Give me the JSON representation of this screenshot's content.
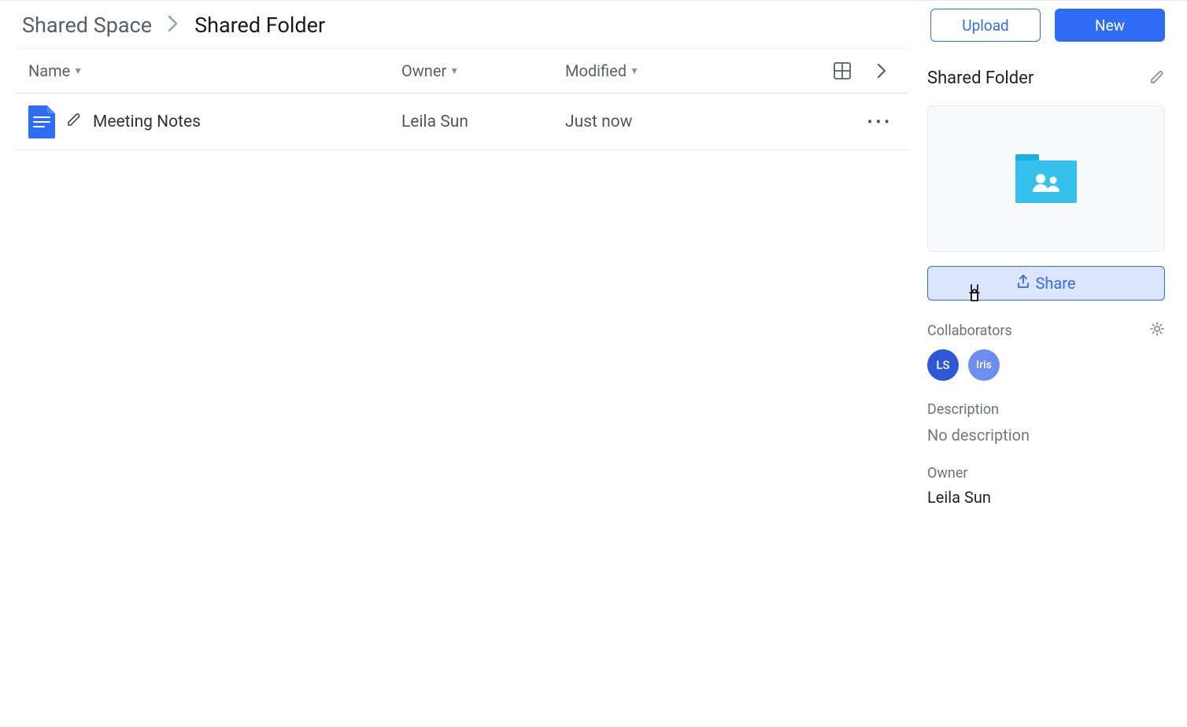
{
  "breadcrumb": {
    "root": "Shared Space",
    "current": "Shared Folder"
  },
  "actions": {
    "upload": "Upload",
    "new": "New"
  },
  "columns": {
    "name": "Name",
    "owner": "Owner",
    "modified": "Modified"
  },
  "rows": [
    {
      "name": "Meeting Notes",
      "owner": "Leila Sun",
      "modified": "Just now"
    }
  ],
  "details": {
    "title": "Shared Folder",
    "share_label": "Share",
    "collaborators_label": "Collaborators",
    "collaborators": [
      {
        "initials": "LS"
      },
      {
        "initials": "Iris"
      }
    ],
    "description_label": "Description",
    "description_value": "No description",
    "owner_label": "Owner",
    "owner_value": "Leila Sun"
  }
}
